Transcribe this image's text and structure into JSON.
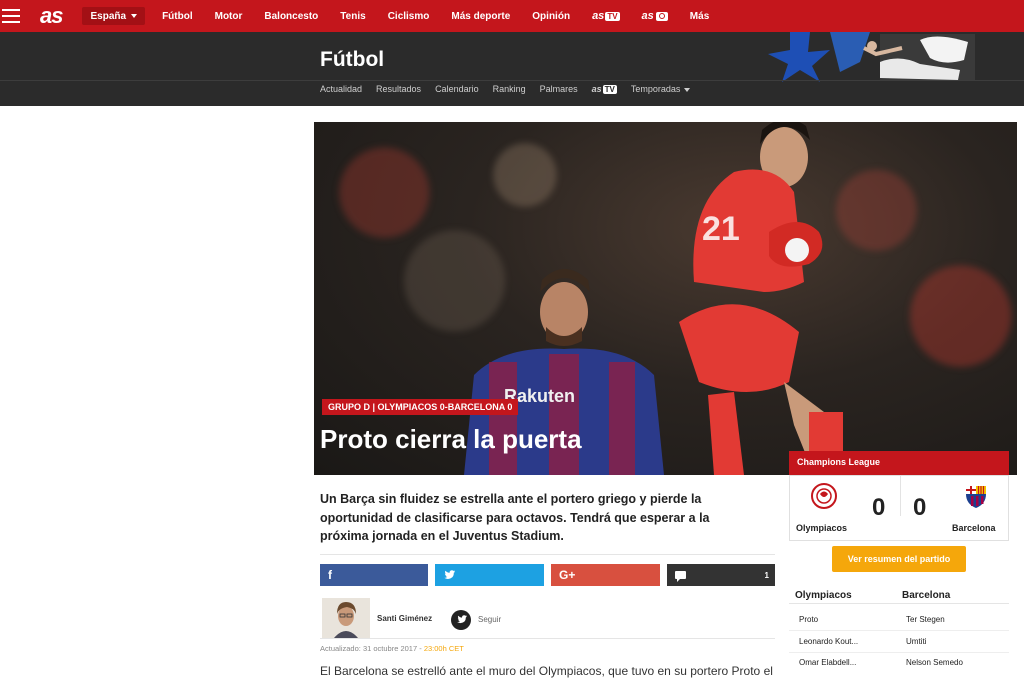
{
  "topbar": {
    "logo": "as",
    "edition": "España",
    "nav": [
      "Fútbol",
      "Motor",
      "Baloncesto",
      "Tenis",
      "Ciclismo",
      "Más deporte",
      "Opinión"
    ],
    "astv": {
      "brand": "as",
      "suffix": "TV"
    },
    "asfoto": {
      "brand": "as"
    },
    "more": "Más"
  },
  "section": {
    "title": "Fútbol",
    "subnav": [
      "Actualidad",
      "Resultados",
      "Calendario",
      "Ranking",
      "Palmares"
    ],
    "astv": {
      "brand": "as",
      "suffix": "TV"
    },
    "seasons": "Temporadas"
  },
  "hero": {
    "label": "GRUPO D | OLYMPIACOS 0-BARCELONA 0",
    "title": "Proto cierra la puerta",
    "shirt_sponsor": "Rakuten",
    "keeper_number": "21"
  },
  "scoreboard": {
    "competition": "Champions League",
    "home": {
      "name": "Olympiacos",
      "score": "0"
    },
    "away": {
      "name": "Barcelona",
      "score": "0"
    },
    "summary_button": "Ver resumen del partido",
    "lineups": {
      "home_header": "Olympiacos",
      "away_header": "Barcelona",
      "rows": [
        [
          "Proto",
          "Ter Stegen"
        ],
        [
          "Leonardo Kout...",
          "Umtiti"
        ],
        [
          "Omar Elabdell...",
          "Nelson Semedo"
        ]
      ]
    }
  },
  "article": {
    "lead": "Un Barça sin fluidez se estrella ante el portero griego y pierde la oportunidad de clasificarse para octavos. Tendrá que esperar a la próxima jornada en el Juventus Stadium.",
    "share": {
      "facebook": "f",
      "twitter": "t",
      "google": "G+",
      "comments": "1"
    },
    "author": "Santi Giménez",
    "follow": "Seguir",
    "updated_label": "Actualizado: 31 octubre 2017 -",
    "updated_time": "23:00h CET",
    "body_first_line": "El Barcelona se estrelló ante el muro del Olympiacos, que tuvo en su portero Proto el"
  },
  "colors": {
    "brand_red": "#c4161c",
    "dark_header": "#2b2b2b",
    "facebook": "#3b5a9a",
    "twitter": "#1da1e2",
    "google": "#d8503f",
    "accent_orange": "#f5a70b"
  }
}
